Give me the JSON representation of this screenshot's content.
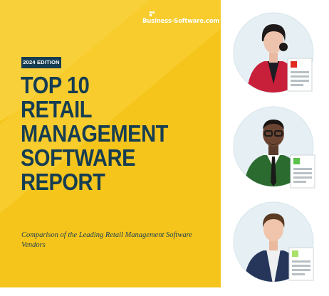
{
  "brand": {
    "name": "Business-Software.com"
  },
  "badge": {
    "edition": "2024 EDITION"
  },
  "report": {
    "title_lines": [
      "TOP 10",
      "RETAIL",
      "MANAGEMENT",
      "SOFTWARE",
      "REPORT"
    ],
    "subtitle": "Comparison of the Leading Retail Management Software Vendors"
  },
  "colors": {
    "cover_yellow": "#f6c51c",
    "cover_yellow_light": "#f8d445",
    "navy": "#163d52",
    "avatar_circle": "#e6f0f4"
  },
  "personas": [
    {
      "icon": "woman-red-blazer-avatar",
      "doc_tab": "#e02b20"
    },
    {
      "icon": "man-green-jacket-avatar",
      "doc_tab": "#5cc24a"
    },
    {
      "icon": "man-navy-jacket-avatar",
      "doc_tab": "#a8e06a"
    }
  ]
}
